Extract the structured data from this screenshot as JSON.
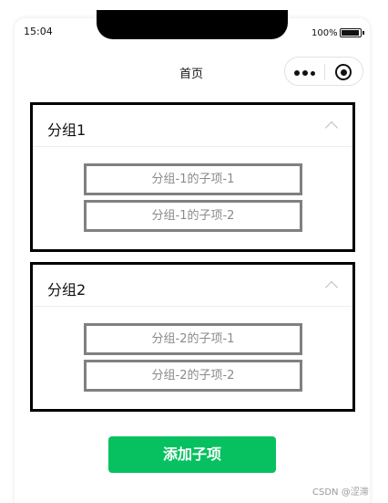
{
  "status_bar": {
    "time": "15:04",
    "battery_text": "100%",
    "battery_level": 1.0
  },
  "nav": {
    "title": "首页",
    "more_icon": "more-dots-icon",
    "close_icon": "target-icon"
  },
  "groups": [
    {
      "title": "分组1",
      "expanded": true,
      "items": [
        "分组-1的子项-1",
        "分组-1的子项-2"
      ]
    },
    {
      "title": "分组2",
      "expanded": true,
      "items": [
        "分组-2的子项-1",
        "分组-2的子项-2"
      ]
    }
  ],
  "actions": {
    "add_child_label": "添加子项"
  },
  "colors": {
    "primary": "#07c160",
    "border": "#000000",
    "item_border": "#808080"
  },
  "watermark": "CSDN @涩滞"
}
